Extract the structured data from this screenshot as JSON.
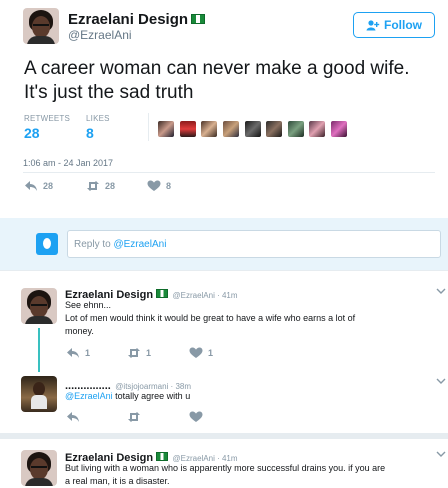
{
  "tweet": {
    "display_name": "Ezraelani Design",
    "handle": "@EzraelAni",
    "follow_label": "Follow",
    "text": "A career woman can never make a good wife. It's just the sad truth",
    "retweets_label": "RETWEETS",
    "retweets_count": "28",
    "likes_label": "LIKES",
    "likes_count": "8",
    "timestamp": "1:06 am - 24 Jan 2017",
    "actions": {
      "reply": "28",
      "retweet": "28",
      "like": "8"
    }
  },
  "composer": {
    "prefix": "Reply to ",
    "mention": "@EzraelAni"
  },
  "replies": [
    {
      "display_name": "Ezraelani Design",
      "handle": "@EzraelAni",
      "time": "41m",
      "line1": "See ehnn...",
      "line2": "Lot of men would think it would be great to have a wife who earns a lot of",
      "line3": "money.",
      "actions": {
        "reply": "1",
        "retweet": "1",
        "like": "1"
      }
    },
    {
      "display_name": "...............",
      "handle": "@itsjojoarmani",
      "time": "38m",
      "mention": "@EzraelAni",
      "text": " totally agree with u"
    },
    {
      "display_name": "Ezraelani Design",
      "handle": "@EzraelAni",
      "time": "41m",
      "line1": "But living with a woman who is apparently more successful drains you. if you are",
      "line2": "a real man, it is a disaster."
    }
  ],
  "colors": {
    "accent": "#1da1f2",
    "thread": "#39c0c0",
    "green_flag": "#1a8a3a"
  }
}
